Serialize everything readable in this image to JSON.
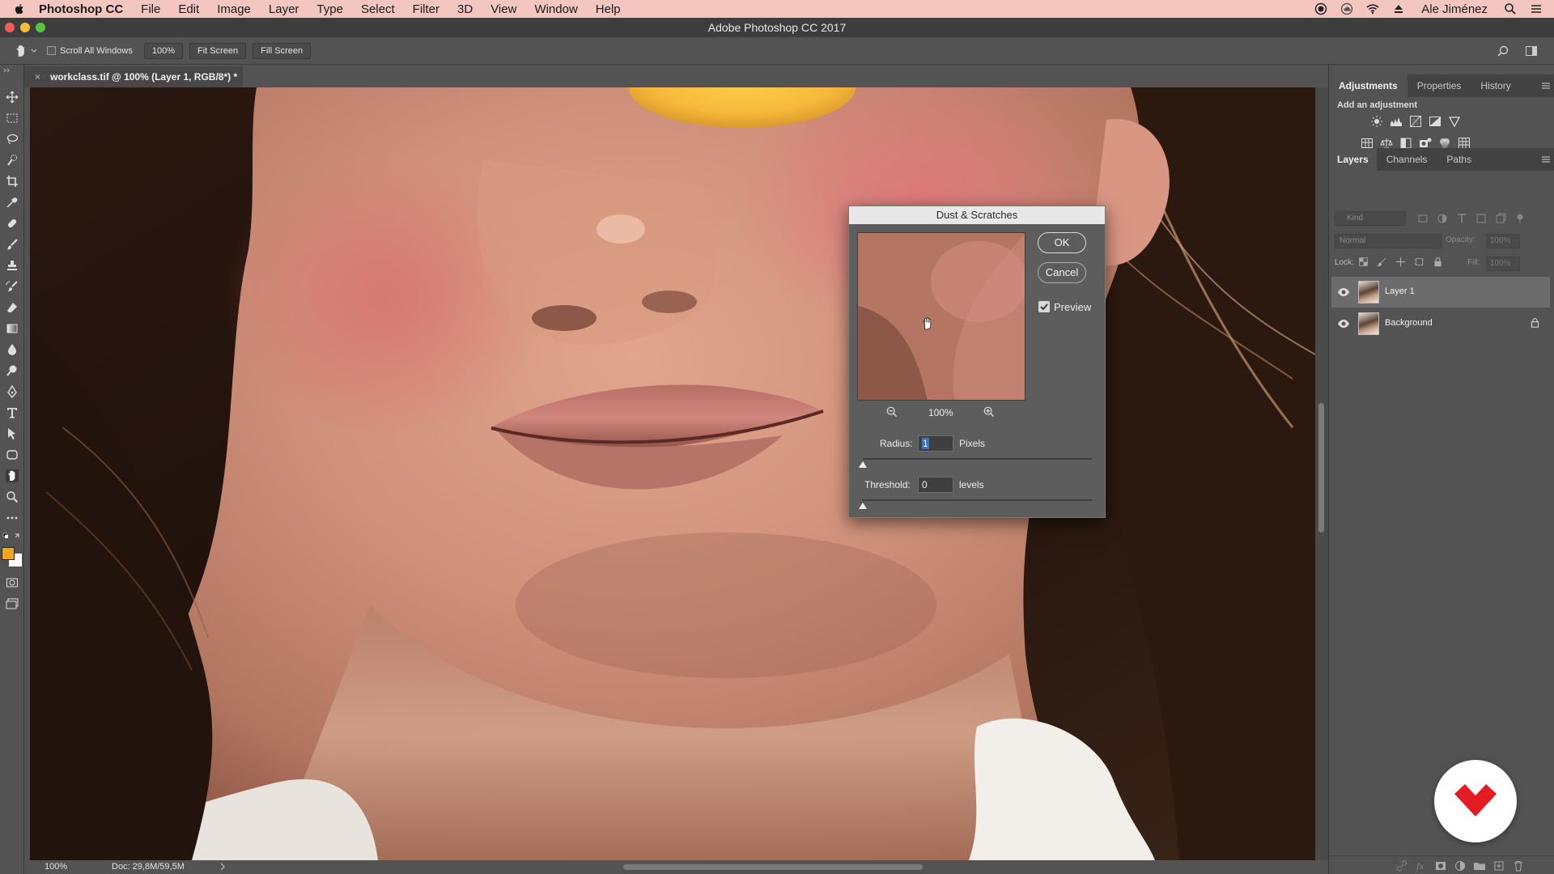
{
  "menubar": {
    "app_name": "Photoshop CC",
    "items": [
      "File",
      "Edit",
      "Image",
      "Layer",
      "Type",
      "Select",
      "Filter",
      "3D",
      "View",
      "Window",
      "Help"
    ],
    "user": "Ale Jiménez",
    "background": "#f3c7c0"
  },
  "window": {
    "title": "Adobe Photoshop CC 2017"
  },
  "options_bar": {
    "scroll_all_windows": "Scroll All Windows",
    "zoom_100": "100%",
    "fit_screen": "Fit Screen",
    "fill_screen": "Fill Screen"
  },
  "document": {
    "tab_title": "workclass.tif @ 100% (Layer 1, RGB/8*) *",
    "close": "×"
  },
  "status_bar": {
    "zoom": "100%",
    "doc_size": "Doc: 29,8M/59,5M"
  },
  "panels": {
    "top_tabs": [
      "Adjustments",
      "Properties",
      "History"
    ],
    "add_adjustment": "Add an adjustment",
    "layer_tabs": [
      "Layers",
      "Channels",
      "Paths"
    ],
    "kind_placeholder": "Kind",
    "blend_mode": "Normal",
    "opacity_label": "Opacity:",
    "opacity_value": "100%",
    "lock_label": "Lock:",
    "fill_label": "Fill:",
    "fill_value": "100%",
    "layers": [
      {
        "name": "Layer 1",
        "selected": true
      },
      {
        "name": "Background",
        "locked": true
      }
    ]
  },
  "dialog": {
    "title": "Dust & Scratches",
    "ok": "OK",
    "cancel": "Cancel",
    "preview_label": "Preview",
    "preview_checked": true,
    "zoom": "100%",
    "radius_label": "Radius:",
    "radius_value": "1",
    "radius_unit": "Pixels",
    "threshold_label": "Threshold:",
    "threshold_value": "0",
    "threshold_unit": "levels"
  },
  "colors": {
    "foreground": "#f3a51c",
    "background": "#ffffff",
    "brand_red": "#e31b23"
  }
}
